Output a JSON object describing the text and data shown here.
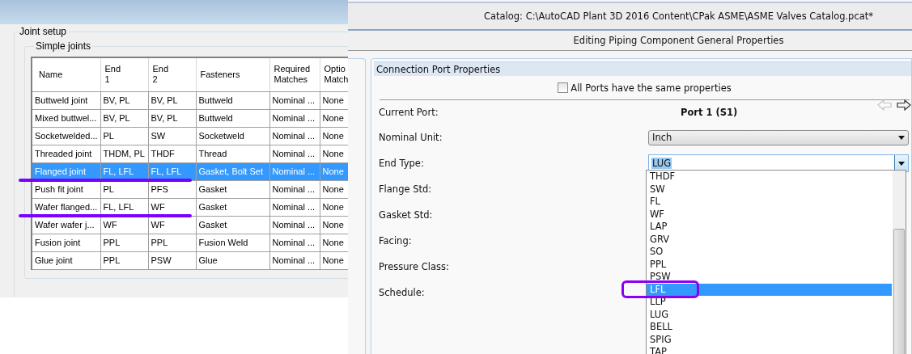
{
  "left_panel": {
    "group_title": "Joint setup",
    "subgroup_title": "Simple joints",
    "table": {
      "columns": [
        "Name",
        "End\n1",
        "End\n2",
        "Fasteners",
        "Required\nMatches",
        "Optio\nMatch"
      ],
      "rows": [
        {
          "cells": [
            "Buttweld joint",
            "BV, PL",
            "BV, PL",
            "Buttweld",
            "Nominal ...",
            "None"
          ],
          "selected": false,
          "underlined": false
        },
        {
          "cells": [
            "Mixed buttwel...",
            "BV, PL",
            "BV, PL",
            "Buttweld",
            "Nominal ...",
            "None"
          ],
          "selected": false,
          "underlined": false
        },
        {
          "cells": [
            "Socketwelded...",
            "PL",
            "SW",
            "Socketweld",
            "Nominal ...",
            "None"
          ],
          "selected": false,
          "underlined": false
        },
        {
          "cells": [
            "Threaded joint",
            "THDM, PL",
            "THDF",
            "Thread",
            "Nominal ...",
            "None"
          ],
          "selected": false,
          "underlined": false
        },
        {
          "cells": [
            "Flanged joint",
            "FL, LFL",
            "FL, LFL",
            "Gasket, Bolt Set",
            "Nominal ...",
            "None"
          ],
          "selected": true,
          "underlined": true
        },
        {
          "cells": [
            "Push fit joint",
            "PL",
            "PFS",
            "Gasket",
            "Nominal ...",
            "None"
          ],
          "selected": false,
          "underlined": false
        },
        {
          "cells": [
            "Wafer flanged...",
            "FL, LFL",
            "WF",
            "Gasket",
            "Nominal ...",
            "None"
          ],
          "selected": false,
          "underlined": true
        },
        {
          "cells": [
            "Wafer wafer j...",
            "WF",
            "WF",
            "Gasket",
            "Nominal ...",
            "None"
          ],
          "selected": false,
          "underlined": false
        },
        {
          "cells": [
            "Fusion joint",
            "PPL",
            "PPL",
            "Fusion Weld",
            "Nominal ...",
            "None"
          ],
          "selected": false,
          "underlined": false
        },
        {
          "cells": [
            "Glue joint",
            "PPL",
            "PSW",
            "Glue",
            "Nominal ...",
            "None"
          ],
          "selected": false,
          "underlined": false
        }
      ]
    }
  },
  "right_panel": {
    "title": "Catalog: C:\\AutoCAD Plant 3D 2016 Content\\CPak ASME\\ASME Valves Catalog.pcat*",
    "subtitle": "Editing Piping Component General Properties",
    "section_title": "Connection Port Properties",
    "same_properties": {
      "label": "All Ports have the same properties",
      "checked": false
    },
    "port_nav": {
      "previous_enabled": false,
      "next_enabled": true
    },
    "fields": [
      {
        "label": "Current Port:",
        "kind": "static",
        "value": "Port 1 (S1)"
      },
      {
        "label": "Nominal Unit:",
        "kind": "select",
        "value": "Inch"
      },
      {
        "label": "End Type:",
        "kind": "combo",
        "value": "LUG",
        "expanded": true
      },
      {
        "label": "Flange Std:",
        "kind": "empty"
      },
      {
        "label": "Gasket Std:",
        "kind": "empty"
      },
      {
        "label": "Facing:",
        "kind": "empty"
      },
      {
        "label": "Pressure Class:",
        "kind": "empty"
      },
      {
        "label": "Schedule:",
        "kind": "empty"
      }
    ],
    "dropdown": {
      "items": [
        {
          "label": "THDF",
          "selected": false,
          "circled": false
        },
        {
          "label": "SW",
          "selected": false,
          "circled": false
        },
        {
          "label": "FL",
          "selected": false,
          "circled": false
        },
        {
          "label": "WF",
          "selected": false,
          "circled": false
        },
        {
          "label": "LAP",
          "selected": false,
          "circled": false
        },
        {
          "label": "GRV",
          "selected": false,
          "circled": false
        },
        {
          "label": "SO",
          "selected": false,
          "circled": false
        },
        {
          "label": "PPL",
          "selected": false,
          "circled": false
        },
        {
          "label": "PSW",
          "selected": false,
          "circled": false
        },
        {
          "label": "LFL",
          "selected": true,
          "circled": true
        },
        {
          "label": "LLP",
          "selected": false,
          "circled": false
        },
        {
          "label": "LUG",
          "selected": false,
          "circled": false
        },
        {
          "label": "BELL",
          "selected": false,
          "circled": false
        },
        {
          "label": "SPIG",
          "selected": false,
          "circled": false
        },
        {
          "label": "TAP",
          "selected": false,
          "circled": false
        }
      ]
    }
  }
}
